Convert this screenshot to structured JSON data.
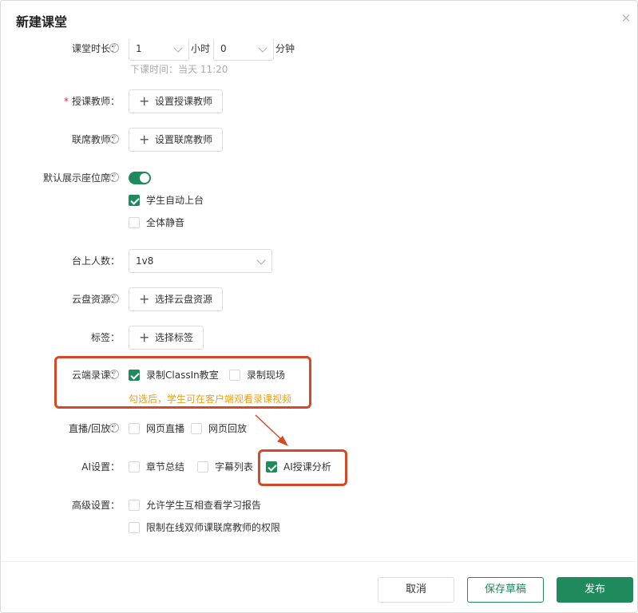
{
  "dialog": {
    "title": "新建课堂",
    "close_icon": "close-icon"
  },
  "duration": {
    "label": "课堂时长",
    "hours_value": "1",
    "hours_unit": "小时",
    "minutes_value": "0",
    "minutes_unit": "分钟",
    "end_time": "下课时间：当天 11:20"
  },
  "teacher": {
    "required_mark": "*",
    "label": "授课教师",
    "button": "设置授课教师"
  },
  "co_teacher": {
    "label": "联席教师",
    "button": "设置联席教师"
  },
  "seats": {
    "label": "默认展示座位席",
    "toggle_on": true,
    "options": [
      {
        "label": "学生自动上台",
        "checked": true
      },
      {
        "label": "全体静音",
        "checked": false
      }
    ]
  },
  "stage_count": {
    "label": "台上人数",
    "value": "1v8"
  },
  "cloud": {
    "label": "云盘资源",
    "button": "选择云盘资源"
  },
  "tags": {
    "label": "标签",
    "colon": "：",
    "button": "选择标签"
  },
  "recording": {
    "label": "云端录课",
    "options": [
      {
        "label": "录制ClassIn教室",
        "checked": true
      },
      {
        "label": "录制现场",
        "checked": false
      }
    ],
    "hint": "勾选后，学生可在客户端观看录课视频"
  },
  "live": {
    "label": "直播/回放",
    "options": [
      {
        "label": "网页直播",
        "checked": false
      },
      {
        "label": "网页回放",
        "checked": false
      }
    ]
  },
  "ai": {
    "label": "AI设置",
    "options": [
      {
        "label": "章节总结",
        "checked": false
      },
      {
        "label": "字幕列表",
        "checked": false
      },
      {
        "label": "AI授课分析",
        "checked": true
      }
    ]
  },
  "advanced": {
    "label": "高级设置",
    "options": [
      {
        "label": "允许学生互相查看学习报告",
        "checked": false
      },
      {
        "label": "限制在线双师课联席教师的权限",
        "checked": false
      }
    ]
  },
  "help_glyph": "?",
  "footer": {
    "cancel": "取消",
    "save_draft": "保存草稿",
    "publish": "发布"
  },
  "colors": {
    "accent": "#1f8a5b",
    "highlight": "#d34a26",
    "hint": "#e8a020"
  }
}
